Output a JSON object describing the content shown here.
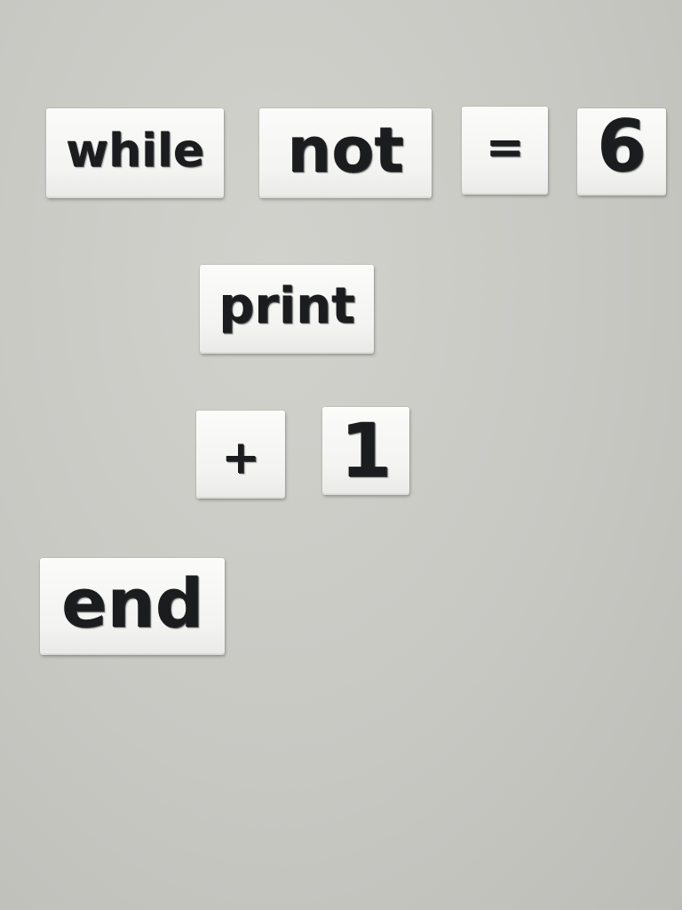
{
  "tiles": {
    "while": "while",
    "not": "not",
    "equals": "=",
    "six": "6",
    "print": "print",
    "plus": "+",
    "one": "1",
    "end": "end"
  }
}
